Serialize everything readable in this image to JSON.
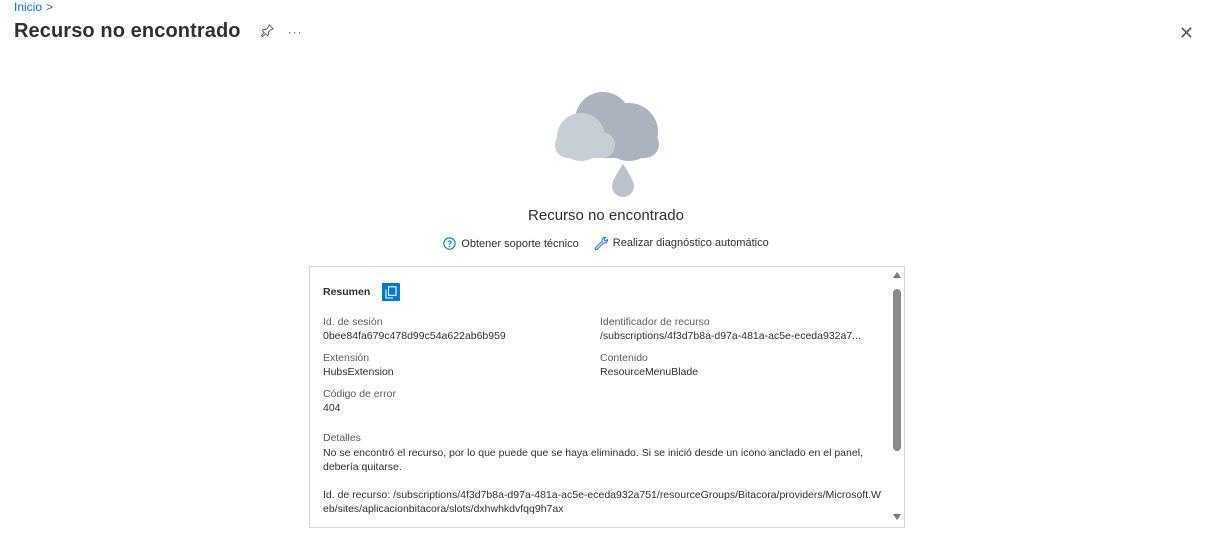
{
  "breadcrumb": {
    "home": "Inicio",
    "separator": ">"
  },
  "header": {
    "title": "Recurso no encontrado",
    "pin_icon": "pin-icon",
    "more_label": "···",
    "close_label": "✕"
  },
  "message": {
    "illustration": "cloud-rain-icon",
    "headline": "Recurso no encontrado",
    "support_link": "Obtener soporte técnico",
    "diagnostics_link": "Realizar diagnóstico automático"
  },
  "summary": {
    "title": "Resumen",
    "copy_icon": "copy-icon",
    "fields": [
      {
        "label": "Id. de sesión",
        "value": "0bee84fa679c478d99c54a622ab6b959"
      },
      {
        "label": "Identificador de recurso",
        "value": "/subscriptions/4f3d7b8a-d97a-481a-ac5e-eceda932a7..."
      },
      {
        "label": "Extensión",
        "value": "HubsExtension"
      },
      {
        "label": "Contenido",
        "value": "ResourceMenuBlade"
      },
      {
        "label": "Código de error",
        "value": "404"
      }
    ],
    "details_label": "Detalles",
    "details_text": "No se encontró el recurso, por lo que puede que se haya eliminado. Si se inició desde un icono anclado en el panel, debería quitarse.",
    "resource_id_text": "Id. de recurso: /subscriptions/4f3d7b8a-d97a-481a-ac5e-eceda932a751/resourceGroups/Bitacora/providers/Microsoft.Web/sites/aplicacionbitacora/slots/dxhwhkdvfqq9h7ax"
  },
  "colors": {
    "link": "#0078d4",
    "cloud_dark": "#a9b3bf",
    "cloud_light": "#c7ced6",
    "drop": "#b9c1ca"
  }
}
